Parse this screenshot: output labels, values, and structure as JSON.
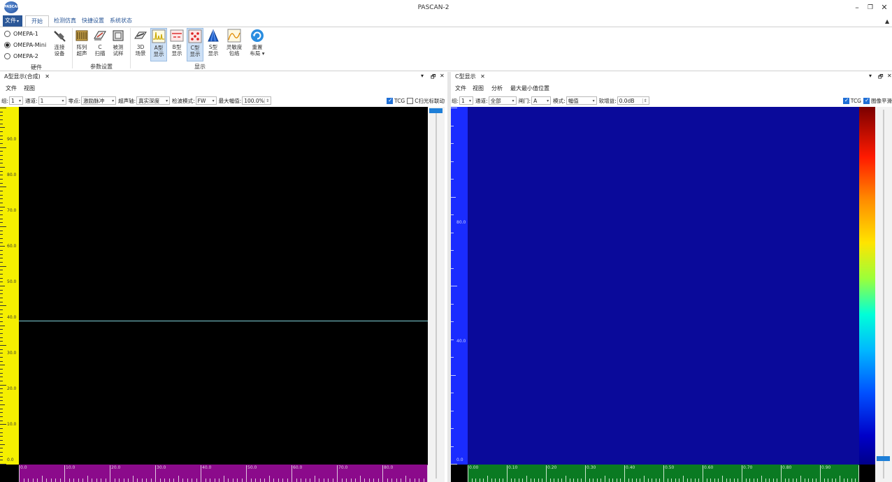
{
  "window": {
    "title": "PASCAN-2",
    "logo_text": "PASCAN",
    "minimize": "–",
    "restore": "❐",
    "close": "✕"
  },
  "ribbon": {
    "file_menu": "文件",
    "tabs": [
      "开始",
      "检测仿真",
      "快捷设置",
      "系统状态"
    ],
    "collapse": "▲",
    "hardware": {
      "label": "硬件",
      "devices": [
        {
          "name": "OMEPA-1",
          "selected": false
        },
        {
          "name": "OMEPA-Mini",
          "selected": true
        },
        {
          "name": "OMEPA-2",
          "selected": false
        }
      ],
      "connect_l1": "连接",
      "connect_l2": "设备"
    },
    "params": {
      "label": "参数设置",
      "array_l1": "阵列",
      "array_l2": "超声",
      "cscan_l1": "C",
      "cscan_l2": "扫描",
      "specimen_l1": "被测",
      "specimen_l2": "试样"
    },
    "display": {
      "label": "显示",
      "d3_l1": "3D",
      "d3_l2": "场景",
      "a_l1": "A型",
      "a_l2": "显示",
      "b_l1": "B型",
      "b_l2": "显示",
      "c_l1": "C型",
      "c_l2": "显示",
      "s_l1": "S型",
      "s_l2": "显示",
      "sens_l1": "灵敏度",
      "sens_l2": "包络",
      "reset_l1": "重置",
      "reset_l2": "布局 ▾"
    }
  },
  "a_pane": {
    "title": "A型显示(合成)",
    "close": "✕",
    "pin": "▾",
    "float": "🗗",
    "menu": [
      "文件",
      "视图"
    ],
    "toolbar": {
      "group_label": "组:",
      "group_value": "1",
      "channel_label": "通道:",
      "channel_value": "1",
      "zero_label": "零点:",
      "zero_value": "激励脉冲",
      "axis_label": "超声轴:",
      "axis_value": "真实深度",
      "mode_label": "检波模式:",
      "mode_value": "FW",
      "amp_label": "最大幅值:",
      "amp_value": "100.0%",
      "tcg_label": "TCG",
      "tcg_checked": true,
      "link_label": "C扫光标联动",
      "link_checked": false
    },
    "y_labels": [
      "90.0",
      "80.0",
      "70.0",
      "60.0",
      "50.0",
      "40.0",
      "30.0",
      "20.0",
      "10.0",
      "0.0"
    ],
    "x_labels": [
      "0.0",
      "10.0",
      "20.0",
      "30.0",
      "40.0",
      "50.0",
      "60.0",
      "70.0",
      "80.0"
    ],
    "colors": {
      "ruler_y": "#f5ef00",
      "ruler_x": "#8b0a8b",
      "plot": "#000000",
      "trace": "#7fd0d8"
    }
  },
  "c_pane": {
    "title": "C型显示",
    "close": "✕",
    "pin": "▾",
    "float": "🗗",
    "menu": [
      "文件",
      "视图",
      "分析",
      "最大最小值位置"
    ],
    "toolbar": {
      "group_label": "组:",
      "group_value": "1",
      "channel_label": "通道:",
      "channel_value": "全部",
      "gate_label": "闸门:",
      "gate_value": "A",
      "mode_label": "模式:",
      "mode_value": "幅值",
      "gain_label": "软增益:",
      "gain_value": "0.0dB",
      "tcg_label": "TCG",
      "tcg_checked": true,
      "smooth_label": "图像平滑",
      "smooth_checked": true
    },
    "y_labels": [
      "80.0",
      "40.0",
      "0.0"
    ],
    "x_labels": [
      "0.00",
      "0.10",
      "0.20",
      "0.30",
      "0.40",
      "0.50",
      "0.60",
      "0.70",
      "0.80",
      "0.90"
    ],
    "colors": {
      "ruler_y": "#1a2cff",
      "ruler_x": "#0a7a22",
      "plot": "#0a0a9a"
    }
  }
}
